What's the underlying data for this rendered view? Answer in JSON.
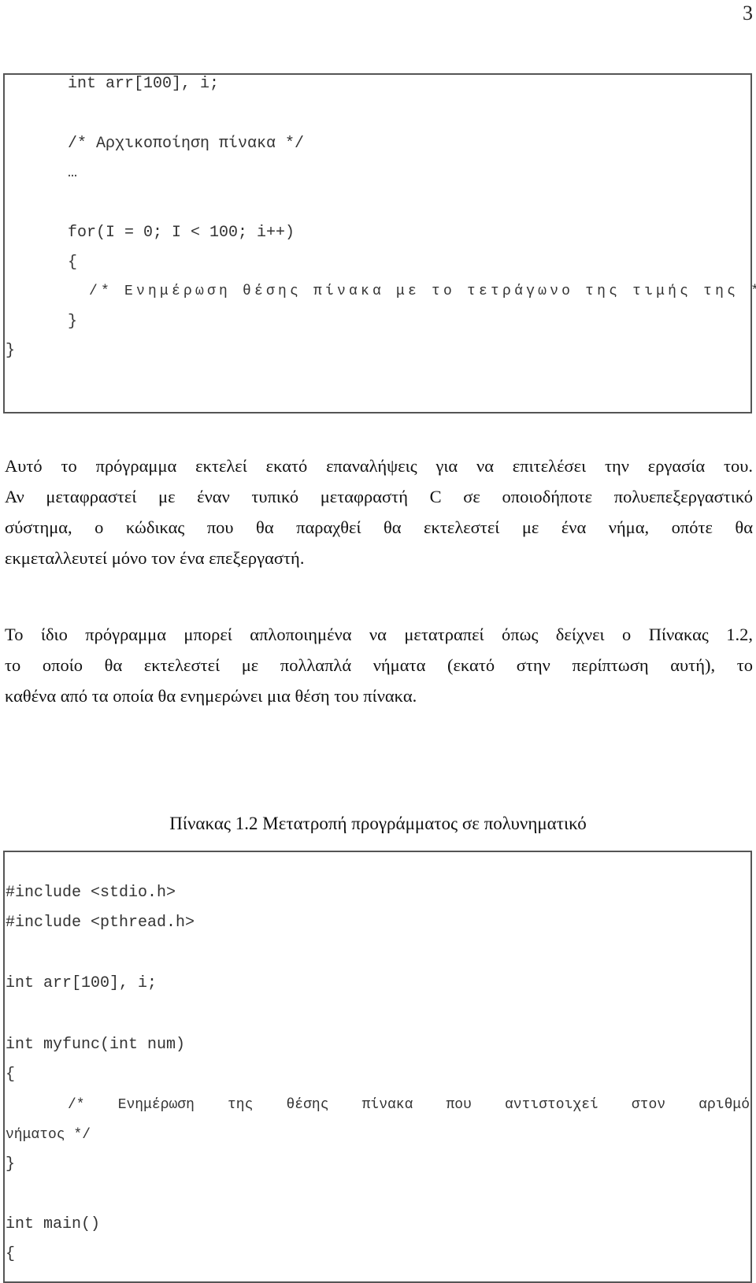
{
  "page_number": "3",
  "code_block_1": {
    "lines": [
      "int arr[100], i;",
      "/* Αρχικοποίηση πίνακα */",
      "…",
      "for(I = 0; I < 100; i++)",
      "{",
      "/* Ενημέρωση θέσης πίνακα με το τετράγωνο της τιμής της */",
      "}",
      "}"
    ]
  },
  "paragraph_1": {
    "lines": [
      "Αυτό το πρόγραμμα εκτελεί εκατό επαναλήψεις για να επιτελέσει την εργασία του.",
      "Αν μεταφραστεί με έναν τυπικό μεταφραστή C σε οποιοδήποτε πολυεπεξεργαστικό",
      "σύστημα, ο κώδικας που θα παραχθεί θα εκτελεστεί με ένα νήμα, οπότε θα",
      "εκμεταλλευτεί μόνο τον ένα επεξεργαστή."
    ]
  },
  "paragraph_2": {
    "lines": [
      "Το ίδιο πρόγραμμα μπορεί απλοποιημένα να μετατραπεί όπως δείχνει ο Πίνακας 1.2,",
      "το οποίο θα εκτελεστεί με πολλαπλά νήματα (εκατό στην περίπτωση αυτή), το",
      "καθένα από τα οποία θα ενημερώνει μια θέση του πίνακα."
    ]
  },
  "table_caption": "Πίνακας 1.2 Μετατροπή προγράμματος σε πολυνηματικό",
  "code_block_2": {
    "lines": [
      "#include <stdio.h>",
      "#include <pthread.h>",
      "int arr[100], i;",
      "int myfunc(int num)",
      "{",
      "/* Ενημέρωση της θέσης πίνακα που αντιστοιχεί στον αριθμό",
      "νήματος */",
      "}",
      "int main()",
      "{"
    ]
  }
}
